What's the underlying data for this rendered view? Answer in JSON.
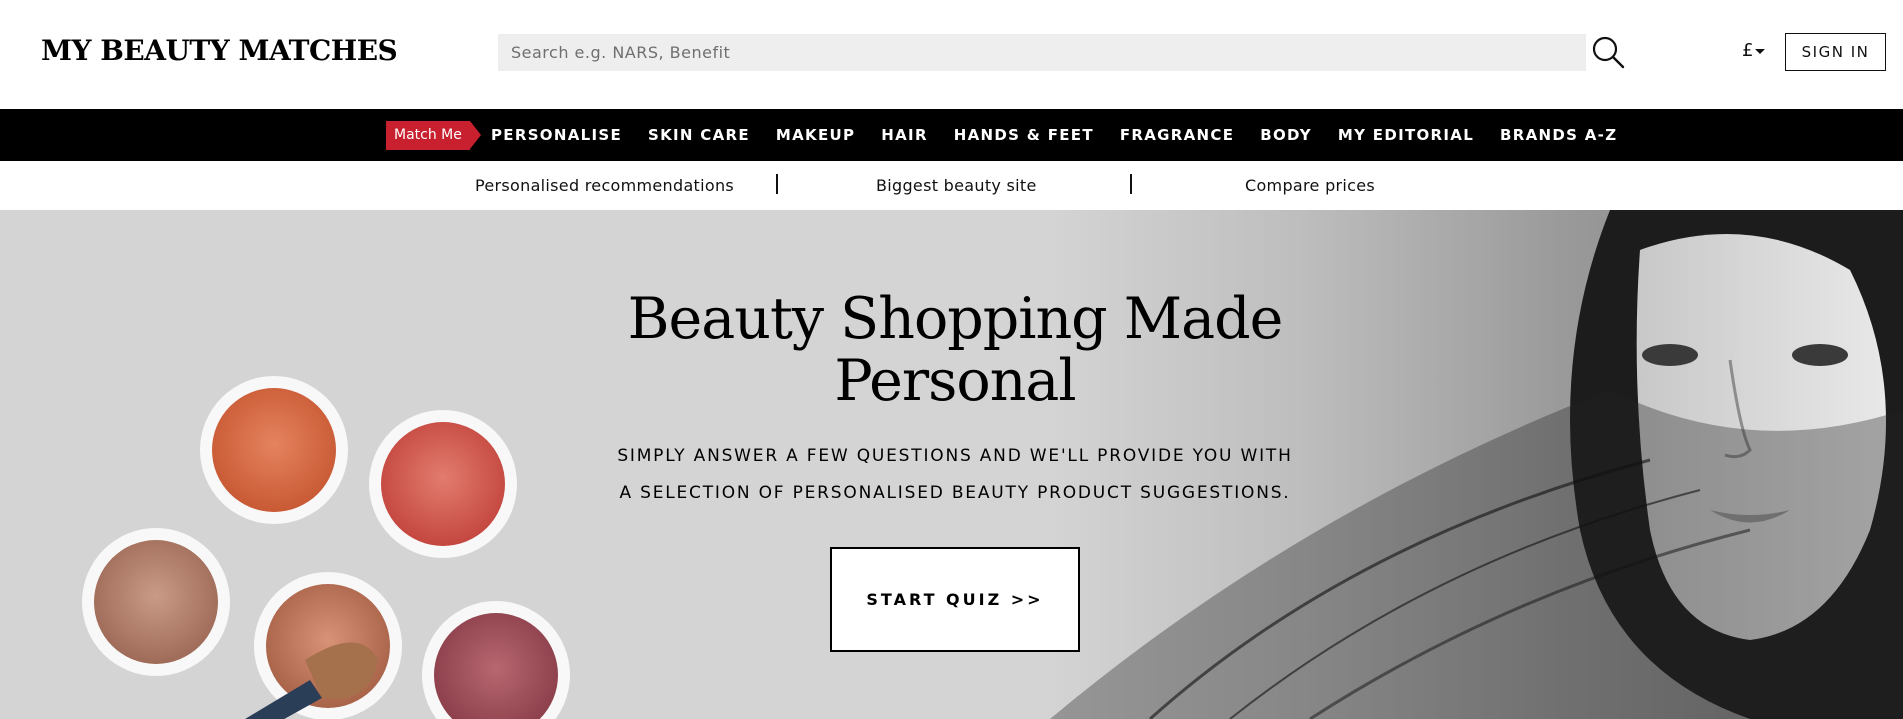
{
  "header": {
    "logo": "MY BEAUTY MATCHES",
    "search_placeholder": "Search e.g. NARS, Benefit",
    "search_icon": "search-icon",
    "currency": "£",
    "signin_label": "SIGN IN"
  },
  "nav": {
    "match_me": "Match Me",
    "items": [
      "PERSONALISE",
      "SKIN CARE",
      "MAKEUP",
      "HAIR",
      "HANDS & FEET",
      "FRAGRANCE",
      "BODY",
      "MY EDITORIAL",
      "BRANDS A-Z"
    ]
  },
  "usp": {
    "items": [
      "Personalised recommendations",
      "Biggest beauty site",
      "Compare prices"
    ]
  },
  "hero": {
    "title_line1": "Beauty Shopping Made",
    "title_line2": "Personal",
    "subtitle_line1": "SIMPLY ANSWER A FEW QUESTIONS AND WE'LL PROVIDE YOU WITH",
    "subtitle_line2": "A SELECTION OF PERSONALISED BEAUTY PRODUCT SUGGESTIONS.",
    "cta_label": "START QUIZ >>"
  },
  "colors": {
    "accent_red": "#c8202f",
    "nav_bg": "#000000",
    "hero_bg": "#d4d4d4",
    "search_bg": "#eeeeee"
  }
}
